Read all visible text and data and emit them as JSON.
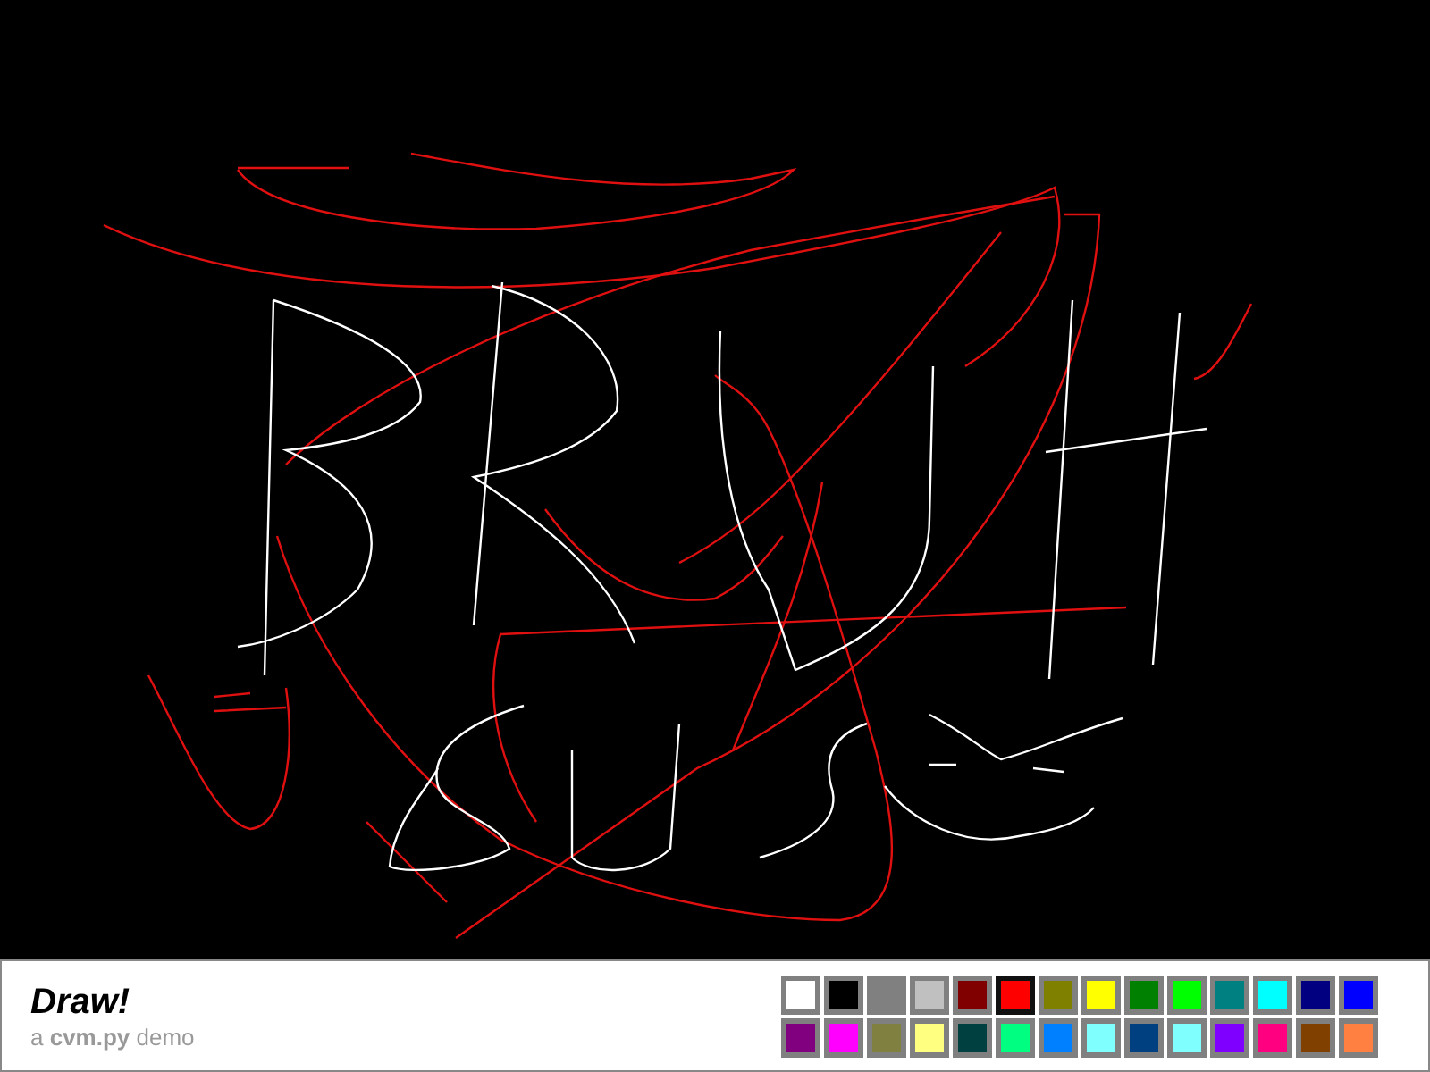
{
  "app": {
    "title": "Draw!",
    "subtitle": "a **cvm.py** demo"
  },
  "palette": [
    {
      "color": "#ffffff",
      "selected": false
    },
    {
      "color": "#000000",
      "selected": false
    },
    {
      "color": "#808080",
      "selected": false
    },
    {
      "color": "#c0c0c0",
      "selected": false
    },
    {
      "color": "#800000",
      "selected": false
    },
    {
      "color": "#ff0000",
      "selected": true
    },
    {
      "color": "#808000",
      "selected": false
    },
    {
      "color": "#ffff00",
      "selected": false
    },
    {
      "color": "#008000",
      "selected": false
    },
    {
      "color": "#00ff00",
      "selected": false
    },
    {
      "color": "#008080",
      "selected": false
    },
    {
      "color": "#00ffff",
      "selected": false
    },
    {
      "color": "#000080",
      "selected": false
    },
    {
      "color": "#0000ff",
      "selected": false
    },
    {
      "color": "#800080",
      "selected": false
    },
    {
      "color": "#ff00ff",
      "selected": false
    },
    {
      "color": "#808040",
      "selected": false
    },
    {
      "color": "#ffff80",
      "selected": false
    },
    {
      "color": "#004040",
      "selected": false
    },
    {
      "color": "#00ff80",
      "selected": false
    },
    {
      "color": "#0080ff",
      "selected": false
    },
    {
      "color": "#80ffff",
      "selected": false
    },
    {
      "color": "#004080",
      "selected": false
    },
    {
      "color": "#80ffff",
      "selected": false
    },
    {
      "color": "#8000ff",
      "selected": false
    },
    {
      "color": "#ff0080",
      "selected": false
    },
    {
      "color": "#804000",
      "selected": false
    },
    {
      "color": "#ff8040",
      "selected": false
    }
  ]
}
